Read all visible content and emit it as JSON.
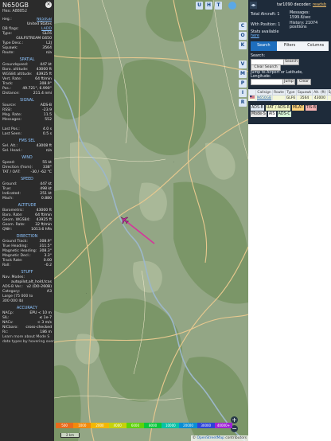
{
  "aircraft": {
    "callsign": "N650GB",
    "hex_label": "Hex: A88852",
    "close_icon": "close-icon"
  },
  "info_rows": [
    {
      "label": "Reg.:",
      "value": "N650GB",
      "link": true
    },
    {
      "label": "",
      "value": "United States"
    },
    {
      "label": "DB flags:",
      "value": "LADD",
      "link": true
    },
    {
      "label": "Type:",
      "value": "GLF6"
    },
    {
      "label": "",
      "value": "GULFSTREAM G650"
    },
    {
      "label": "Type Desc.:",
      "value": "L2J"
    },
    {
      "label": "Squawk:",
      "value": "3564"
    },
    {
      "label": "Route:",
      "value": "n/a"
    }
  ],
  "sections": [
    {
      "title": "SPATIAL",
      "rows": [
        {
          "label": "Groundspeed:",
          "value": "447 kt"
        },
        {
          "label": "Baro. altitude:",
          "value": "43000 ft"
        },
        {
          "label": "WGS84 altitude:",
          "value": "43925 ft"
        },
        {
          "label": "Vert. Rate:",
          "value": "64 ft/min"
        },
        {
          "label": "Track:",
          "value": "308.9°"
        },
        {
          "label": "Pos.:",
          "value": "49.721°, 6.990°"
        },
        {
          "label": "Distance:",
          "value": "211.4 nmi"
        }
      ]
    },
    {
      "title": "SIGNAL",
      "rows": [
        {
          "label": "Source:",
          "value": "ADS-B"
        },
        {
          "label": "RSSI:",
          "value": "-23.9"
        },
        {
          "label": "Msg. Rate:",
          "value": "11.5"
        },
        {
          "label": "Messages:",
          "value": "552"
        },
        {
          "label": "",
          "value": ""
        },
        {
          "label": "Last Pos.:",
          "value": "4.0 s"
        },
        {
          "label": "Last Seen:",
          "value": "0.5 s"
        }
      ]
    },
    {
      "title": "FMS SEL",
      "rows": [
        {
          "label": "Sel. Alt.:",
          "value": "43008 ft"
        },
        {
          "label": "Sel. Head.:",
          "value": "n/a"
        }
      ]
    },
    {
      "title": "WIND",
      "rows": [
        {
          "label": "Speed:",
          "value": "55 kt"
        },
        {
          "label": "Direction (from):",
          "value": "338°"
        },
        {
          "label": "TAT / OAT:",
          "value": "-30 / -62 °C"
        }
      ]
    },
    {
      "title": "SPEED",
      "rows": [
        {
          "label": "Ground:",
          "value": "447 kt"
        },
        {
          "label": "True:",
          "value": "498 kt"
        },
        {
          "label": "Indicated:",
          "value": "251 kt"
        },
        {
          "label": "Mach:",
          "value": "0.880"
        }
      ]
    },
    {
      "title": "ALTITUDE",
      "rows": [
        {
          "label": "Barometric:",
          "value": "43000 ft"
        },
        {
          "label": "Baro. Rate:",
          "value": "64 ft/min"
        },
        {
          "label": "Geom. WGS84:",
          "value": "43925 ft"
        },
        {
          "label": "Geom. Rate:",
          "value": "32 ft/min"
        },
        {
          "label": "QNH:",
          "value": "1013.6 hPa"
        }
      ]
    },
    {
      "title": "DIRECTION",
      "rows": [
        {
          "label": "Ground Track:",
          "value": "308.9°"
        },
        {
          "label": "True Heading:",
          "value": "311.5°"
        },
        {
          "label": "Magnetic Heading:",
          "value": "308.3°"
        },
        {
          "label": "Magnetic Decl.:",
          "value": "3.3°"
        },
        {
          "label": "Track Rate:",
          "value": "0.00"
        },
        {
          "label": "Roll:",
          "value": "-0.2"
        }
      ]
    },
    {
      "title": "STUFF",
      "rows": [
        {
          "label": "Nav. Modes:",
          "value": ""
        },
        {
          "label": "",
          "value": "autopilot,alt_hold,tcas"
        },
        {
          "label": "ADS-B Ver.:",
          "value": "v2 (DO-260B)"
        },
        {
          "label": "Category:",
          "value": "A3"
        },
        {
          "label": "Large (75 000 to",
          "value": ""
        },
        {
          "label": "300 000 lb)",
          "value": ""
        }
      ]
    },
    {
      "title": "ACCURACY",
      "rows": [
        {
          "label": "NACp:",
          "value": "EPU < 10 m"
        },
        {
          "label": "SIL:",
          "value": "≤ 1e-7"
        },
        {
          "label": "NACv:",
          "value": "< 3 m/s"
        },
        {
          "label": "NICbaro:",
          "value": "cross-checked"
        },
        {
          "label": "Rc:",
          "value": "186 m"
        }
      ]
    }
  ],
  "footer_note": [
    "Learn more about Mode S",
    "data types by hovering over"
  ],
  "map": {
    "top_buttons": [
      "U",
      "H",
      "T"
    ],
    "column_buttons": [
      "C",
      "O",
      "K",
      "V",
      "M",
      "P",
      "I",
      "R"
    ],
    "zoom_in": "+",
    "zoom_out": "−",
    "altitude_legend": [
      "500",
      "1000",
      "2000",
      "4000",
      "6000",
      "8000",
      "10000",
      "20000",
      "30000",
      "40000+"
    ],
    "scale_label": "2 km",
    "attribution_prefix": "© ",
    "attribution_link": "OpenStreetMap",
    "attribution_suffix": " contributors",
    "colors": {
      "forest": "#7b9668",
      "field": "#a4b493",
      "road": "#e9c98f",
      "track": "#d6339b"
    }
  },
  "sidebar": {
    "version_prefix": "tar1090 decoder:",
    "version_link": "readsb",
    "total_aircraft": "Total Aircraft: 1",
    "messages": "Messages:",
    "messages_rate": "1599.6/sec",
    "with_position": "With Position: 1",
    "history": "History: 21074",
    "history2": "positions",
    "stats": "Stats available",
    "stats_link": "here",
    "tabs": [
      {
        "label": "Search",
        "active": true
      },
      {
        "label": "Filters",
        "active": false
      },
      {
        "label": "Columns",
        "active": false
      }
    ],
    "search_label": "Search:",
    "search_button": "Search",
    "clear_search": "Clear Search",
    "jump_label": "Jump to Airport or Latitude, Longitude:",
    "jump_button": "Jump",
    "clear_button": "Clear",
    "columns": [
      "",
      "Callsign",
      "Route",
      "Type",
      "Squawk",
      "Alt. (ft)",
      "Spd"
    ],
    "rows": [
      {
        "flag": "US",
        "callsign": "N650GB",
        "route": "",
        "type": "GLF6",
        "squawk": "3564",
        "alt": "43000",
        "spd": ""
      }
    ],
    "source_legend_1": [
      "ADS-B",
      "UAT / ADS-R",
      "MLAT",
      "TIS-B"
    ],
    "source_legend_2": [
      "Mode-S",
      "AIS",
      "ADS-C"
    ],
    "arrows_icon": "arrows-icon"
  }
}
